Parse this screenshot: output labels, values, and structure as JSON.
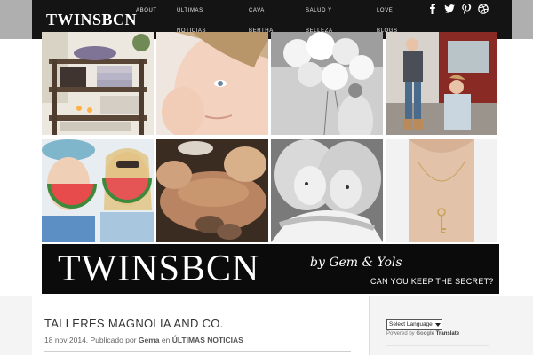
{
  "header": {
    "logo": "TWINSBCN",
    "nav": [
      {
        "label": "About"
      },
      {
        "label": "Últimas"
      },
      {
        "label": "Cava"
      },
      {
        "label": "Salud y"
      },
      {
        "label": "Love"
      },
      {
        "label": "Noticias"
      },
      {
        "label": "Bertha"
      },
      {
        "label": "Belleza"
      },
      {
        "label": "Blogs"
      }
    ],
    "social": [
      {
        "icon": "facebook-icon"
      },
      {
        "icon": "twitter-icon"
      },
      {
        "icon": "pinterest-icon"
      },
      {
        "icon": "dribbble-icon"
      }
    ]
  },
  "grid": {
    "tiles": [
      {
        "subject": "shelf-with-towels-and-candles"
      },
      {
        "subject": "child-face-closeup"
      },
      {
        "subject": "white-balloons"
      },
      {
        "subject": "mother-and-child-on-street"
      },
      {
        "subject": "girls-eating-watermelon"
      },
      {
        "subject": "back-massage"
      },
      {
        "subject": "twin-girls-hugging"
      },
      {
        "subject": "gold-key-necklace"
      }
    ]
  },
  "banner": {
    "title": "TWINSBCN",
    "byline": "by Gem & Yols",
    "tagline": "CAN YOU KEEP THE SECRET?"
  },
  "post": {
    "title": "TALLERES MAGNOLIA AND CO.",
    "date": "18 nov 2014",
    "published_by": ", Publicado por",
    "author": "Gema",
    "in_word": "en",
    "category": "ÚLTIMAS NOTICIAS"
  },
  "sidebar": {
    "language_select": "Select Language",
    "powered_by": "Powered by",
    "google": "Google",
    "translate": "Translate"
  },
  "colors": {
    "topbar": "#141414",
    "banner": "#0b0b0b",
    "text": "#333333"
  }
}
